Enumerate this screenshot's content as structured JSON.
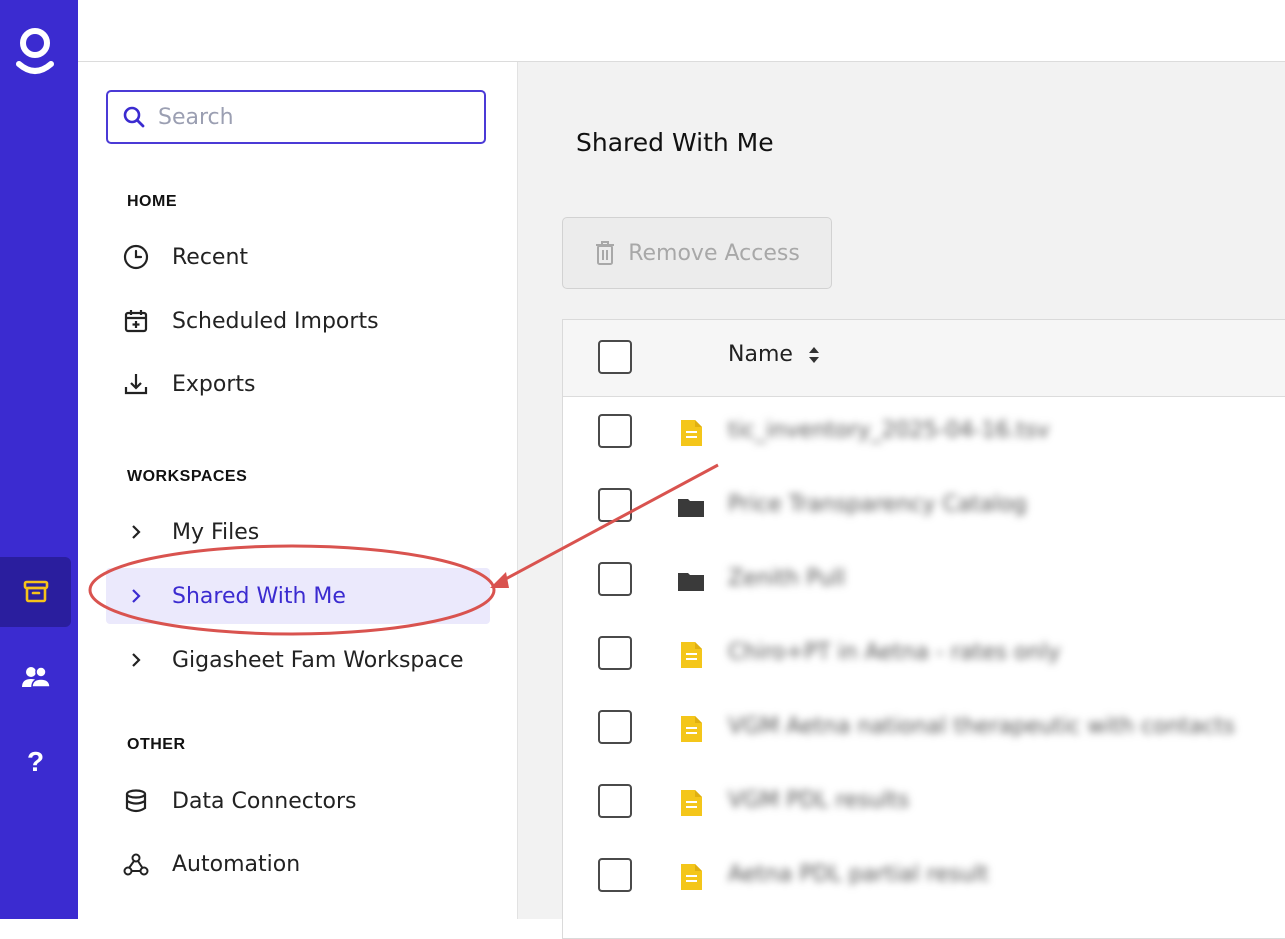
{
  "app": {
    "brand_color": "#3b2bd0",
    "rail": [
      {
        "icon": "archive-icon",
        "active": true
      },
      {
        "icon": "people-icon",
        "active": false
      },
      {
        "icon": "help-icon",
        "active": false
      }
    ],
    "help_glyph": "?"
  },
  "sidebar": {
    "search": {
      "placeholder": "Search",
      "value": ""
    },
    "sections": {
      "home": "HOME",
      "workspaces": "WORKSPACES",
      "other": "OTHER"
    },
    "home_items": [
      {
        "label": "Recent",
        "icon": "clock-icon"
      },
      {
        "label": "Scheduled Imports",
        "icon": "calendar-plus-icon"
      },
      {
        "label": "Exports",
        "icon": "download-icon"
      }
    ],
    "workspace_items": [
      {
        "label": "My Files",
        "icon": "chevron-right-icon",
        "active": false
      },
      {
        "label": "Shared With Me",
        "icon": "chevron-right-icon",
        "active": true
      },
      {
        "label": "Gigasheet Fam Workspace",
        "icon": "chevron-right-icon",
        "active": false
      }
    ],
    "other_items": [
      {
        "label": "Data Connectors",
        "icon": "database-icon"
      },
      {
        "label": "Automation",
        "icon": "webhook-icon"
      }
    ]
  },
  "main": {
    "title": "Shared With Me",
    "remove_access_label": "Remove Access",
    "table": {
      "name_header": "Name",
      "rows": [
        {
          "type": "file",
          "icon": "file-icon",
          "name": "tic_inventory_2025-04-16.tsv"
        },
        {
          "type": "folder",
          "icon": "folder-icon",
          "name": "Price Transparency Catalog"
        },
        {
          "type": "folder",
          "icon": "folder-icon",
          "name": "Zenith Pull"
        },
        {
          "type": "file",
          "icon": "file-icon",
          "name": "Chiro+PT in Aetna - rates only"
        },
        {
          "type": "file",
          "icon": "file-icon",
          "name": "VGM Aetna national therapeutic with contacts"
        },
        {
          "type": "file",
          "icon": "file-icon",
          "name": "VGM PDL results"
        },
        {
          "type": "file",
          "icon": "file-icon",
          "name": "Aetna PDL partial result"
        }
      ]
    }
  },
  "annotation": {
    "color": "#d9534f",
    "target": "Shared With Me"
  }
}
